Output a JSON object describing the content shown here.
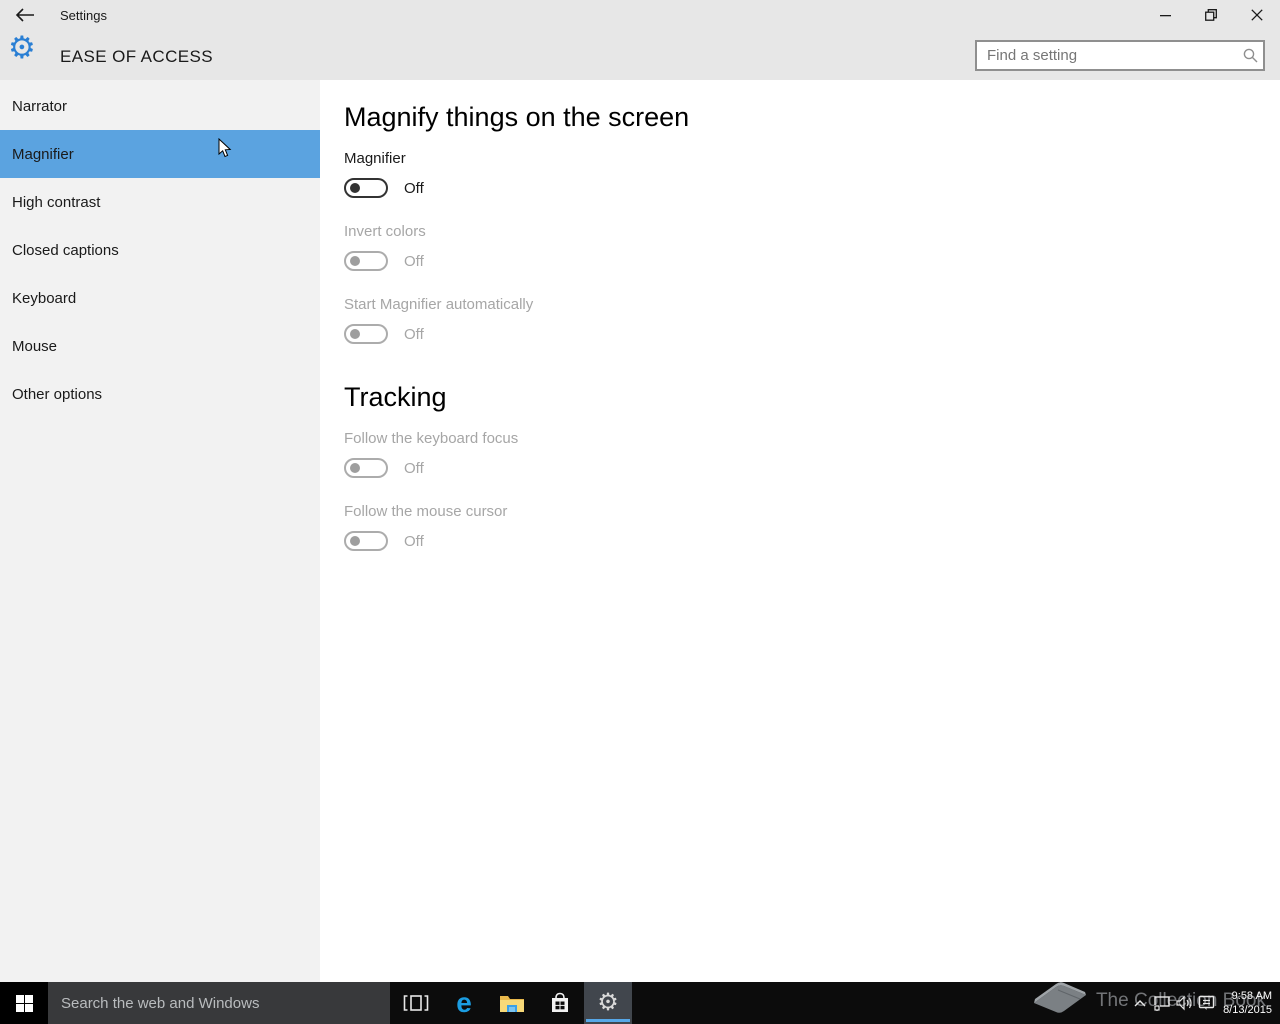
{
  "titlebar": {
    "title": "Settings"
  },
  "header": {
    "category": "EASE OF ACCESS",
    "search_placeholder": "Find a setting",
    "gear_icon": "gear",
    "accent_color": "#2a7fd4"
  },
  "sidebar": {
    "selected_color": "#5ba3e0",
    "background": "#f2f2f2",
    "items": [
      {
        "label": "Narrator",
        "selected": false
      },
      {
        "label": "Magnifier",
        "selected": true
      },
      {
        "label": "High contrast",
        "selected": false
      },
      {
        "label": "Closed captions",
        "selected": false
      },
      {
        "label": "Keyboard",
        "selected": false
      },
      {
        "label": "Mouse",
        "selected": false
      },
      {
        "label": "Other options",
        "selected": false
      }
    ]
  },
  "main": {
    "sections": [
      {
        "heading": "Magnify things on the screen",
        "settings": [
          {
            "label": "Magnifier",
            "state": "Off",
            "enabled": true
          },
          {
            "label": "Invert colors",
            "state": "Off",
            "enabled": false
          },
          {
            "label": "Start Magnifier automatically",
            "state": "Off",
            "enabled": false
          }
        ]
      },
      {
        "heading": "Tracking",
        "settings": [
          {
            "label": "Follow the keyboard focus",
            "state": "Off",
            "enabled": false
          },
          {
            "label": "Follow the mouse cursor",
            "state": "Off",
            "enabled": false
          }
        ]
      }
    ]
  },
  "taskbar": {
    "background": "#0c0c0c",
    "search_placeholder": "Search the web and Windows",
    "apps": [
      {
        "name": "task-view",
        "active": false
      },
      {
        "name": "edge",
        "active": false
      },
      {
        "name": "file-explorer",
        "active": false
      },
      {
        "name": "store",
        "active": false
      },
      {
        "name": "settings",
        "active": true
      }
    ],
    "active_underline_color": "#57a8e8",
    "watermark": "The Collection Book",
    "tray": {
      "icons": [
        "chevron-up",
        "network",
        "volume",
        "action-center"
      ],
      "time": "9:58 AM",
      "date": "8/13/2015"
    }
  }
}
